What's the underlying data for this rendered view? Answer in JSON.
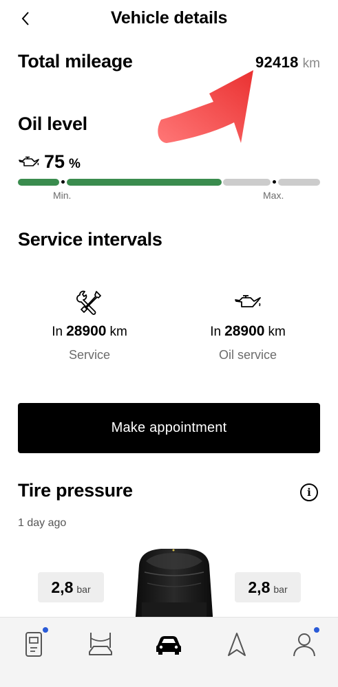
{
  "header": {
    "title": "Vehicle details",
    "back_icon": "chevron-left-icon"
  },
  "mileage": {
    "title": "Total mileage",
    "value": "92418",
    "unit": "km"
  },
  "oil": {
    "title": "Oil level",
    "percent": "75",
    "unit": "%",
    "level_fraction": 0.75,
    "min_label": "Min.",
    "max_label": "Max.",
    "icon": "oil-can-icon"
  },
  "service": {
    "title": "Service intervals",
    "items": [
      {
        "prefix": "In",
        "value": "28900",
        "unit": "km",
        "label": "Service",
        "icon": "wrench-screwdriver-icon"
      },
      {
        "prefix": "In",
        "value": "28900",
        "unit": "km",
        "label": "Oil service",
        "icon": "oil-can-icon"
      }
    ],
    "appointment_label": "Make appointment"
  },
  "tires": {
    "title": "Tire pressure",
    "updated": "1 day ago",
    "front_left": {
      "value": "2,8",
      "unit": "bar"
    },
    "front_right": {
      "value": "2,8",
      "unit": "bar"
    }
  },
  "tabbar": {
    "items": [
      {
        "icon": "vehicle-key-icon",
        "badge": true
      },
      {
        "icon": "car-service-icon",
        "badge": false
      },
      {
        "icon": "car-front-icon",
        "badge": false,
        "active": true
      },
      {
        "icon": "navigation-arrow-icon",
        "badge": false
      },
      {
        "icon": "profile-icon",
        "badge": true
      }
    ]
  },
  "colors": {
    "gauge_green": "#3a8c4e",
    "gauge_gray": "#cccccc",
    "badge_blue": "#2a5bd7",
    "annotation_red": "#f03a3a"
  }
}
